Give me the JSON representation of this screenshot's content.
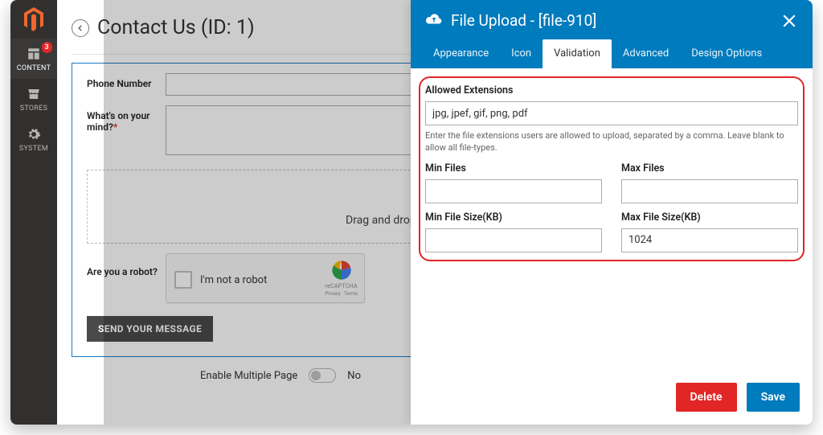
{
  "colors": {
    "accent": "#007bbd",
    "danger": "#e22626",
    "link": "#1979c3"
  },
  "sidebar": {
    "items": [
      {
        "name": "content",
        "label": "CONTENT",
        "badge": "3",
        "active": true
      },
      {
        "name": "stores",
        "label": "STORES"
      },
      {
        "name": "system",
        "label": "SYSTEM"
      }
    ]
  },
  "page": {
    "title": "Contact Us (ID: 1)"
  },
  "form": {
    "phone_label": "Phone Number",
    "phone_value": "",
    "mind_label": "What's on your mind?",
    "mind_required": "*",
    "mind_value": "",
    "dropzone_text": "Drag and drop files or click to select",
    "captcha_label_left": "Are you a robot?",
    "captcha_checkbox_label": "I'm not a robot",
    "captcha_brand": "reCAPTCHA",
    "captcha_links": "Privacy · Terms",
    "send_label": "SEND YOUR MESSAGE",
    "enable_multiple_label": "Enable Multiple Page",
    "enable_multiple_value": "No"
  },
  "modal": {
    "title": "File Upload - [file-910]",
    "tabs": [
      {
        "label": "Appearance"
      },
      {
        "label": "Icon"
      },
      {
        "label": "Validation",
        "active": true
      },
      {
        "label": "Advanced"
      },
      {
        "label": "Design Options"
      }
    ],
    "validation": {
      "allowed_ext_label": "Allowed Extensions",
      "allowed_ext_value": "jpg, jpef, gif, png, pdf",
      "allowed_ext_help": "Enter the file extensions users are allowed to upload, separated by a comma. Leave blank to allow all file-types.",
      "min_files_label": "Min Files",
      "min_files_value": "",
      "max_files_label": "Max Files",
      "max_files_value": "",
      "min_size_label": "Min File Size(KB)",
      "min_size_value": "",
      "max_size_label": "Max File Size(KB)",
      "max_size_value": "1024"
    },
    "buttons": {
      "delete": "Delete",
      "save": "Save"
    }
  }
}
